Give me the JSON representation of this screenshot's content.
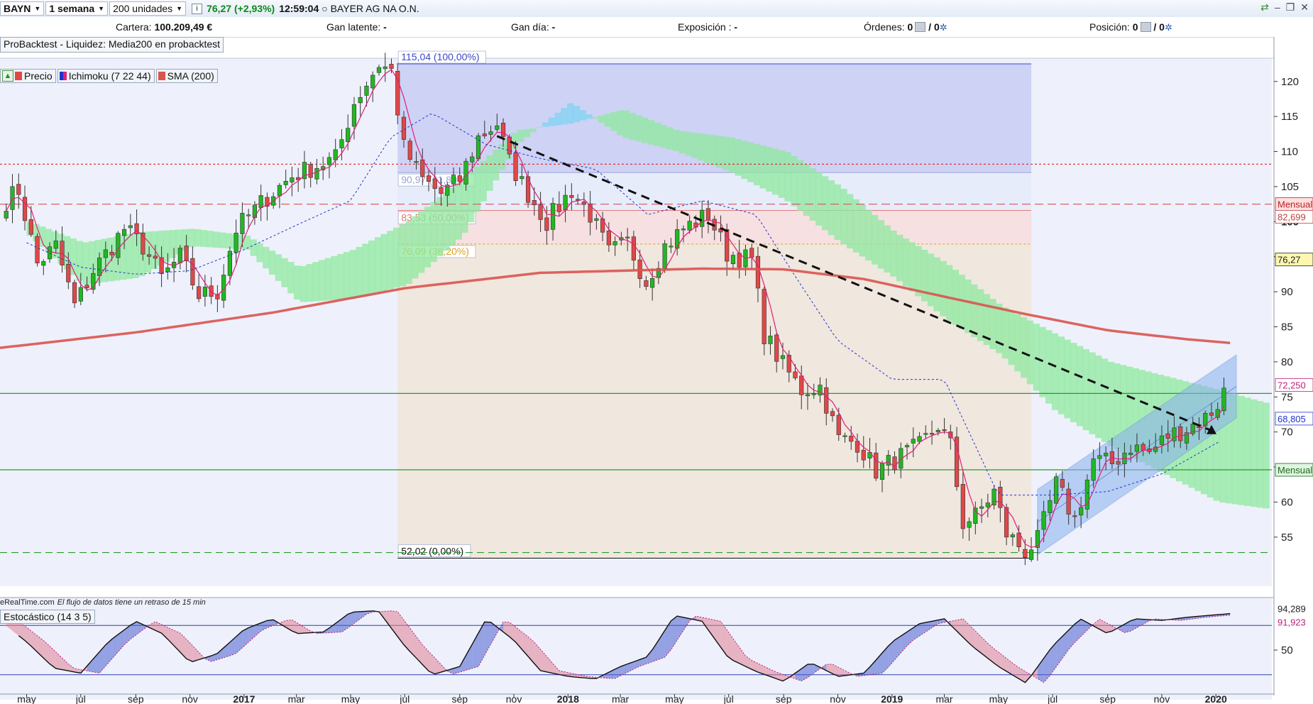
{
  "toolbar": {
    "ticker": "BAYN",
    "timeframe": "1 semana",
    "units": "200 unidades",
    "price_change": "76,27 (+2,93%)",
    "time": "12:59:04",
    "instrument_name": "BAYER AG NA O.N."
  },
  "infobar": {
    "cartera_label": "Cartera:",
    "cartera_value": "100.209,49 €",
    "gan_latente_label": "Gan latente:",
    "gan_latente_value": "-",
    "gan_dia_label": "Gan día:",
    "gan_dia_value": "-",
    "exposicion_label": "Exposición :",
    "exposicion_value": "-",
    "ordenes_label": "Órdenes:",
    "ordenes_value": "0",
    "ordenes_value2": "/ 0",
    "posicion_label": "Posición:",
    "posicion_value": "0",
    "posicion_value2": "/ 0"
  },
  "backtest_label": "ProBacktest - Liquidez: Media200 en probacktest",
  "legend": {
    "price": "Precio",
    "ichimoku": "Ichimoku (7 22 44)",
    "sma": "SMA (200)"
  },
  "delay_source": "eRealTime.com",
  "delay_note": "El flujo de datos tiene un retraso de 15 min",
  "stoch_label": "Estocástico (14 3 5)",
  "colors": {
    "bull": "#22b722",
    "bear": "#e04848",
    "sma": "#d9534f",
    "ichimoku_tenkan": "#e0207a",
    "ichimoku_kijun": "#2233cc",
    "kumo_bull": "#8fe89f",
    "kumo_bear": "#7fd3f2",
    "fib_band": "#c8cdf3"
  },
  "chart_data": {
    "type": "candlestick",
    "y_range": [
      48,
      122
    ],
    "y_ticks": [
      55,
      60,
      65,
      70,
      75,
      80,
      85,
      90,
      95,
      100,
      105,
      110,
      115,
      120
    ],
    "x_labels": [
      {
        "date": "2016-05-01",
        "label": "may",
        "bold": false
      },
      {
        "date": "2016-07-01",
        "label": "jul",
        "bold": false
      },
      {
        "date": "2016-09-01",
        "label": "sep",
        "bold": false
      },
      {
        "date": "2016-11-01",
        "label": "nov",
        "bold": false
      },
      {
        "date": "2017-01-01",
        "label": "2017",
        "bold": true
      },
      {
        "date": "2017-03-01",
        "label": "mar",
        "bold": false
      },
      {
        "date": "2017-05-01",
        "label": "may",
        "bold": false
      },
      {
        "date": "2017-07-01",
        "label": "jul",
        "bold": false
      },
      {
        "date": "2017-09-01",
        "label": "sep",
        "bold": false
      },
      {
        "date": "2017-11-01",
        "label": "nov",
        "bold": false
      },
      {
        "date": "2018-01-01",
        "label": "2018",
        "bold": true
      },
      {
        "date": "2018-03-01",
        "label": "mar",
        "bold": false
      },
      {
        "date": "2018-05-01",
        "label": "may",
        "bold": false
      },
      {
        "date": "2018-07-01",
        "label": "jul",
        "bold": false
      },
      {
        "date": "2018-09-01",
        "label": "sep",
        "bold": false
      },
      {
        "date": "2018-11-01",
        "label": "nov",
        "bold": false
      },
      {
        "date": "2019-01-01",
        "label": "2019",
        "bold": true
      },
      {
        "date": "2019-03-01",
        "label": "mar",
        "bold": false
      },
      {
        "date": "2019-05-01",
        "label": "may",
        "bold": false
      },
      {
        "date": "2019-07-01",
        "label": "jul",
        "bold": false
      },
      {
        "date": "2019-09-01",
        "label": "sep",
        "bold": false
      },
      {
        "date": "2019-11-01",
        "label": "nov",
        "bold": false
      },
      {
        "date": "2020-01-01",
        "label": "2020",
        "bold": true
      }
    ],
    "close_anchors": [
      [
        "2016-04-08",
        103
      ],
      [
        "2016-04-22",
        104.5
      ],
      [
        "2016-05-13",
        94
      ],
      [
        "2016-06-03",
        96.5
      ],
      [
        "2016-06-24",
        88
      ],
      [
        "2016-07-15",
        93
      ],
      [
        "2016-08-19",
        99
      ],
      [
        "2016-09-09",
        96.5
      ],
      [
        "2016-09-30",
        92
      ],
      [
        "2016-10-21",
        95
      ],
      [
        "2016-11-11",
        89.5
      ],
      [
        "2016-12-02",
        90
      ],
      [
        "2016-12-23",
        99
      ],
      [
        "2017-01-27",
        103.5
      ],
      [
        "2017-02-24",
        106.5
      ],
      [
        "2017-03-24",
        108
      ],
      [
        "2017-04-14",
        109
      ],
      [
        "2017-05-05",
        117
      ],
      [
        "2017-06-02",
        122.5
      ],
      [
        "2017-06-16",
        121.5
      ],
      [
        "2017-06-30",
        110.5
      ],
      [
        "2017-07-21",
        106
      ],
      [
        "2017-08-11",
        104
      ],
      [
        "2017-09-01",
        106
      ],
      [
        "2017-09-22",
        112
      ],
      [
        "2017-10-13",
        114
      ],
      [
        "2017-10-27",
        108.5
      ],
      [
        "2017-11-17",
        104
      ],
      [
        "2017-12-08",
        100
      ],
      [
        "2018-01-05",
        104.5
      ],
      [
        "2018-01-26",
        101
      ],
      [
        "2018-02-16",
        95.5
      ],
      [
        "2018-03-09",
        97
      ],
      [
        "2018-03-30",
        91.5
      ],
      [
        "2018-04-20",
        96.5
      ],
      [
        "2018-05-11",
        99
      ],
      [
        "2018-06-08",
        101
      ],
      [
        "2018-06-29",
        95.5
      ],
      [
        "2018-07-27",
        94.5
      ],
      [
        "2018-08-10",
        84
      ],
      [
        "2018-08-31",
        79.5
      ],
      [
        "2018-09-21",
        76
      ],
      [
        "2018-10-12",
        76.5
      ],
      [
        "2018-11-02",
        69
      ],
      [
        "2018-11-23",
        68.5
      ],
      [
        "2018-12-14",
        64.5
      ],
      [
        "2019-01-11",
        66.5
      ],
      [
        "2019-02-01",
        68
      ],
      [
        "2019-02-22",
        71
      ],
      [
        "2019-03-08",
        68
      ],
      [
        "2019-03-22",
        57
      ],
      [
        "2019-04-05",
        58
      ],
      [
        "2019-04-26",
        61.5
      ],
      [
        "2019-05-10",
        55.5
      ],
      [
        "2019-05-31",
        53
      ],
      [
        "2019-06-14",
        54.5
      ],
      [
        "2019-07-05",
        62.5
      ],
      [
        "2019-07-26",
        57.5
      ],
      [
        "2019-08-16",
        66
      ],
      [
        "2019-09-06",
        65.5
      ],
      [
        "2019-09-27",
        68
      ],
      [
        "2019-10-18",
        67
      ],
      [
        "2019-11-08",
        69.5
      ],
      [
        "2019-11-29",
        70.5
      ],
      [
        "2019-12-20",
        72
      ],
      [
        "2020-01-03",
        74
      ],
      [
        "2020-01-10",
        76.27
      ]
    ],
    "sma200_anchors": [
      [
        "2016-04-01",
        82
      ],
      [
        "2016-09-01",
        84.2
      ],
      [
        "2017-02-01",
        87
      ],
      [
        "2017-07-01",
        90.5
      ],
      [
        "2017-12-01",
        92.7
      ],
      [
        "2018-06-01",
        93.3
      ],
      [
        "2018-09-01",
        93.2
      ],
      [
        "2018-12-01",
        91.8
      ],
      [
        "2019-03-01",
        89.3
      ],
      [
        "2019-06-01",
        86.8
      ],
      [
        "2019-09-01",
        84.5
      ],
      [
        "2019-12-01",
        83.2
      ],
      [
        "2020-01-17",
        82.699
      ]
    ],
    "kijun_anchors": [
      [
        "2016-05-01",
        97
      ],
      [
        "2016-07-01",
        93.5
      ],
      [
        "2016-09-01",
        92.5
      ],
      [
        "2016-11-01",
        93
      ],
      [
        "2017-01-01",
        96
      ],
      [
        "2017-03-01",
        99.5
      ],
      [
        "2017-05-01",
        103
      ],
      [
        "2017-06-15",
        112
      ],
      [
        "2017-08-01",
        115.5
      ],
      [
        "2017-10-01",
        111
      ],
      [
        "2017-12-01",
        109
      ],
      [
        "2018-02-01",
        107.5
      ],
      [
        "2018-04-01",
        101
      ],
      [
        "2018-06-01",
        103
      ],
      [
        "2018-08-01",
        101
      ],
      [
        "2018-09-15",
        92
      ],
      [
        "2018-11-01",
        83
      ],
      [
        "2019-01-01",
        77.5
      ],
      [
        "2019-03-01",
        77.5
      ],
      [
        "2019-05-01",
        61
      ],
      [
        "2019-07-01",
        61
      ],
      [
        "2019-09-01",
        61.5
      ],
      [
        "2019-11-01",
        64
      ],
      [
        "2020-01-10",
        69
      ]
    ],
    "kumo_a_anchors": [
      [
        "2016-05-01",
        98
      ],
      [
        "2016-07-01",
        91
      ],
      [
        "2016-09-01",
        92
      ],
      [
        "2016-11-01",
        96.5
      ],
      [
        "2017-01-01",
        96
      ],
      [
        "2017-03-01",
        88.5
      ],
      [
        "2017-05-01",
        89
      ],
      [
        "2017-07-01",
        91
      ],
      [
        "2017-09-01",
        98
      ],
      [
        "2017-11-01",
        111
      ],
      [
        "2018-01-01",
        117
      ],
      [
        "2018-03-01",
        112
      ],
      [
        "2018-05-01",
        110
      ],
      [
        "2018-07-01",
        107
      ],
      [
        "2018-09-01",
        103
      ],
      [
        "2018-11-01",
        97
      ],
      [
        "2019-01-01",
        92
      ],
      [
        "2019-03-01",
        86
      ],
      [
        "2019-05-01",
        81
      ],
      [
        "2019-07-01",
        73
      ],
      [
        "2019-09-01",
        68
      ],
      [
        "2019-11-01",
        64
      ],
      [
        "2020-01-01",
        60
      ],
      [
        "2020-02-28",
        59
      ]
    ],
    "kumo_b_anchors": [
      [
        "2016-05-01",
        100
      ],
      [
        "2016-07-01",
        97
      ],
      [
        "2016-09-01",
        98.5
      ],
      [
        "2016-11-01",
        99
      ],
      [
        "2017-01-01",
        98
      ],
      [
        "2017-03-01",
        93.5
      ],
      [
        "2017-05-01",
        96
      ],
      [
        "2017-07-01",
        100
      ],
      [
        "2017-09-01",
        106
      ],
      [
        "2017-11-01",
        113
      ],
      [
        "2018-01-01",
        114
      ],
      [
        "2018-03-01",
        116
      ],
      [
        "2018-05-01",
        113
      ],
      [
        "2018-07-01",
        112
      ],
      [
        "2018-09-01",
        110
      ],
      [
        "2018-11-01",
        105
      ],
      [
        "2019-01-01",
        98.5
      ],
      [
        "2019-03-01",
        94
      ],
      [
        "2019-05-01",
        88
      ],
      [
        "2019-07-01",
        84
      ],
      [
        "2019-09-01",
        80
      ],
      [
        "2019-11-01",
        78
      ],
      [
        "2020-01-01",
        76
      ],
      [
        "2020-02-28",
        74
      ]
    ],
    "fibonacci": {
      "start_date": "2017-06-23",
      "end_date": "2019-06-07",
      "levels": [
        {
          "label": "115,04 (100,00%)",
          "value": 122.5,
          "color": "#3a48c9"
        },
        {
          "label": "90,97 (61,80%)",
          "value": 107.0,
          "color": "#9aa3d8"
        },
        {
          "label": "83,53 (50,00%)",
          "value": 101.6,
          "color": "#e07a7a"
        },
        {
          "label": "76,09 (38,20%)",
          "value": 96.8,
          "color": "#e0a020"
        },
        {
          "label": "52,02 (0,00%)",
          "value": 52.0,
          "color": "#111111"
        }
      ]
    },
    "trendline": {
      "from": [
        "2017-10-13",
        112.2
      ],
      "to": [
        "2019-12-27",
        70.2
      ]
    },
    "channel": {
      "upper": [
        [
          "2019-06-14",
          61.8
        ],
        [
          "2020-01-24",
          81
        ]
      ],
      "lower": [
        [
          "2019-06-14",
          52.5
        ],
        [
          "2020-01-24",
          72
        ]
      ]
    },
    "horizontal_lines": [
      {
        "value": 102.5,
        "color": "#e06060",
        "dash": "12,6"
      },
      {
        "value": 108.2,
        "color": "#e02020",
        "dash": "3,3"
      },
      {
        "value": 64.6,
        "color": "#2a9a2a",
        "dash": ""
      },
      {
        "value": 75.5,
        "color": "#2a9a2a",
        "dash": ""
      },
      {
        "value": 52.8,
        "color": "#2a9a2a",
        "dash": "10,6"
      }
    ],
    "axis_tags": [
      {
        "text": "Mensual",
        "value": 102.5,
        "bg": "#fde0e0",
        "color": "#c02020"
      },
      {
        "text": "82,699",
        "value": 100.7,
        "bg": "#ffffff",
        "color": "#c04040"
      },
      {
        "text": "76,27",
        "value": 94.6,
        "bg": "#fff7b0",
        "color": "#222222"
      },
      {
        "text": "72,250",
        "value": 76.7,
        "bg": "#ffffff",
        "color": "#c0207a"
      },
      {
        "text": "68,805",
        "value": 71.9,
        "bg": "#ffffff",
        "color": "#2233cc"
      },
      {
        "text": "Mensual",
        "value": 64.6,
        "bg": "#e0f5e0",
        "color": "#1a6a1a"
      }
    ],
    "stochastic": {
      "levels": [
        80,
        50,
        20
      ],
      "anchors": [
        [
          "2016-04-01",
          85
        ],
        [
          "2016-05-01",
          60
        ],
        [
          "2016-06-01",
          28
        ],
        [
          "2016-07-01",
          22
        ],
        [
          "2016-08-01",
          60
        ],
        [
          "2016-09-01",
          85
        ],
        [
          "2016-10-01",
          70
        ],
        [
          "2016-11-01",
          35
        ],
        [
          "2016-12-01",
          45
        ],
        [
          "2017-01-01",
          75
        ],
        [
          "2017-02-01",
          88
        ],
        [
          "2017-03-01",
          70
        ],
        [
          "2017-04-01",
          72
        ],
        [
          "2017-05-01",
          96
        ],
        [
          "2017-06-01",
          98
        ],
        [
          "2017-07-01",
          55
        ],
        [
          "2017-08-01",
          20
        ],
        [
          "2017-09-01",
          30
        ],
        [
          "2017-10-01",
          88
        ],
        [
          "2017-11-01",
          62
        ],
        [
          "2017-12-01",
          25
        ],
        [
          "2018-01-01",
          18
        ],
        [
          "2018-02-01",
          15
        ],
        [
          "2018-03-01",
          30
        ],
        [
          "2018-04-01",
          42
        ],
        [
          "2018-05-01",
          92
        ],
        [
          "2018-06-01",
          85
        ],
        [
          "2018-07-01",
          40
        ],
        [
          "2018-08-01",
          24
        ],
        [
          "2018-09-01",
          12
        ],
        [
          "2018-10-01",
          35
        ],
        [
          "2018-11-01",
          18
        ],
        [
          "2018-12-01",
          22
        ],
        [
          "2019-01-01",
          60
        ],
        [
          "2019-02-01",
          82
        ],
        [
          "2019-03-01",
          88
        ],
        [
          "2019-04-01",
          55
        ],
        [
          "2019-05-01",
          30
        ],
        [
          "2019-06-01",
          10
        ],
        [
          "2019-07-01",
          55
        ],
        [
          "2019-08-01",
          88
        ],
        [
          "2019-09-01",
          70
        ],
        [
          "2019-10-01",
          88
        ],
        [
          "2019-11-01",
          86
        ],
        [
          "2019-12-01",
          90
        ],
        [
          "2020-01-17",
          94.289
        ]
      ],
      "signal_last": 91.923,
      "tags": [
        {
          "text": "94,289",
          "value": 94.289,
          "color": "#222222"
        },
        {
          "text": "91,923",
          "value": 91.923,
          "color": "#c0207a"
        }
      ]
    }
  }
}
